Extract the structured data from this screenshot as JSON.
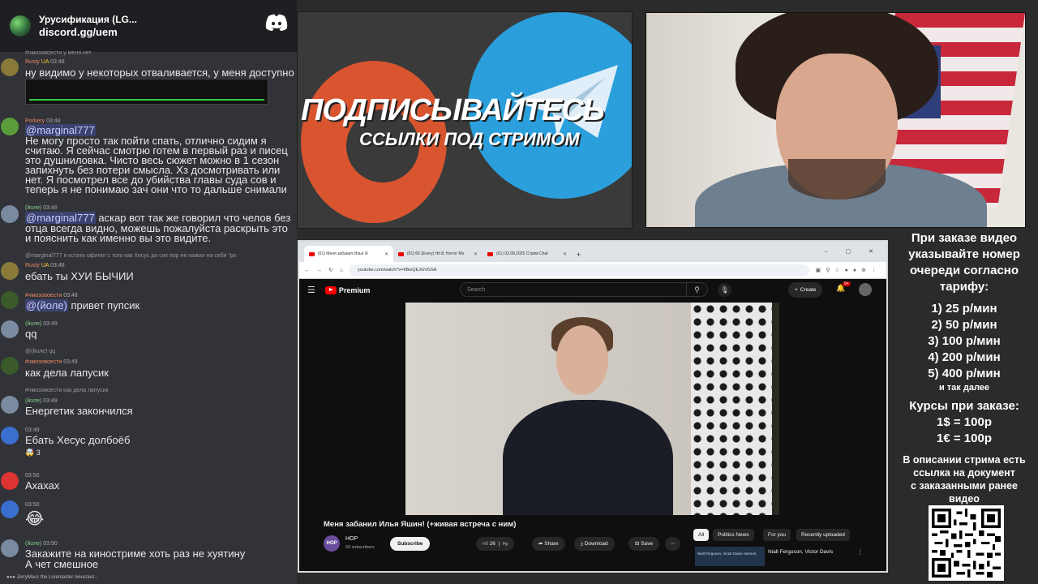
{
  "discord": {
    "title": "Урусификация (LG...",
    "invite": "discord.gg/uem"
  },
  "chat": {
    "m1": {
      "reply": "#чмозовоести у меня нет",
      "name": "Rusty",
      "badge": "UA",
      "time": "03:48",
      "text": "ну видимо у некоторых отваливается, у меня доступно"
    },
    "m2": {
      "name": "Porkery",
      "time": "03:48",
      "mention": "@marginal777",
      "lines": [
        "Не могу просто так пойти спать, отлично сидим я",
        "считаю. Я сейчас смотрю готем в первый раз и писец",
        "это душниловка. Чисто весь сюжет можно в 1 сезон",
        "запихнуть без потери смысла. Хз досмотривать или",
        "нет. Я посмотрел все до убийства главы суда сов и",
        "теперь я не понимаю зач они что то дальше снимали"
      ]
    },
    "m3": {
      "name": "(йоле)",
      "time": "03:48",
      "mention": "@marginal777",
      "lines": [
        " аскар вот так же говорил что челов без",
        "отца всегда видно, можешь пожалуйста раскрыть это",
        "и пояснить как именно вы это видите."
      ]
    },
    "m4": {
      "reply": "@marginal777 я кстати офигел с того как Хесус до сих пор не нажил на себя \"ро",
      "name": "Rusty",
      "badge": "UA",
      "time": "03:48",
      "text": "ебать ты ХУИ БЫЧИИ"
    },
    "m5": {
      "name": "#чмозовоести",
      "time": "03:48",
      "mention": "@(йоле)",
      "text": " привет пупсик"
    },
    "m6": {
      "name": "(йоле)",
      "time": "03:49",
      "text": "qq"
    },
    "m7": {
      "reply": "@(йоле) qq",
      "name": "#чмозовоести",
      "time": "03:49",
      "text": "как дела лапусик"
    },
    "m8": {
      "reply": "#чмозовоести как дела лапусик",
      "name": "(йоле)",
      "time": "03:49",
      "text": "Енергетик закончился"
    },
    "m9": {
      "time": "03:49",
      "text": "Ебать Хесус долбоёб",
      "reaction": "3"
    },
    "m10": {
      "time": "03:50",
      "text": "Ахахах"
    },
    "m11": {
      "time": "03:50",
      "text": "😂"
    },
    "m12": {
      "name": "(йоле)",
      "time": "03:50",
      "lines": [
        "Закажите на киностриме хоть раз не хуятину",
        "А чет смешное"
      ]
    },
    "typing": "JerryMacc the Loremaster печатает..."
  },
  "banner": {
    "headline": "ПОДПИСЫВАЙТЕСЬ",
    "subline": "ССЫЛКИ ПОД СТРИМОМ"
  },
  "browser": {
    "tabs": [
      "(61) Меня забанил Илья Я",
      "(61) 66 (Every) Hit 8: Horror Mo",
      "(61) 02.09.2025 Стрим Chat"
    ],
    "url": "youtube.com/watch?v=9BwQEJGVGSA",
    "yt": {
      "logo": "Premium",
      "search_placeholder": "Search",
      "create": "Create",
      "notif": "9+",
      "video_title": "Меня забанил Илья Яшин! (+живая встреча с ним)",
      "channel": "НОР",
      "channel_short": "HOP",
      "subs": "43 subscribers",
      "subscribe": "Subscribe",
      "likes": "26",
      "share": "Share",
      "download": "Download",
      "save": "Save",
      "chips": [
        "All",
        "Politics News",
        "For you",
        "Recently uploaded"
      ],
      "rec_thumb": "Niall Ferguson, Victor Davis Hanson,",
      "rec_title": "Niall Ferguson, Victor Davis"
    }
  },
  "info": {
    "l1": "При заказе видео",
    "l2": "указывайте номер",
    "l3": "очереди согласно",
    "l4": "тарифу:",
    "t1": "1) 25 р/мин",
    "t2": "2) 50 р/мин",
    "t3": "3) 100 р/мин",
    "t4": "4) 200 р/мин",
    "t5": "5) 400 р/мин",
    "etc": "и так далее",
    "c1": "Курсы при заказе:",
    "c2": "1$ = 100р",
    "c3": "1€ = 100р",
    "d1": "В описании стрима есть",
    "d2": "ссылка на документ",
    "d3": "с заказанными ранее",
    "d4": "видео"
  },
  "colors": {
    "chat_bg": "#313338",
    "yt_red": "#ff0000",
    "boosty": "#e0562e",
    "telegram": "#2a9fdc"
  }
}
